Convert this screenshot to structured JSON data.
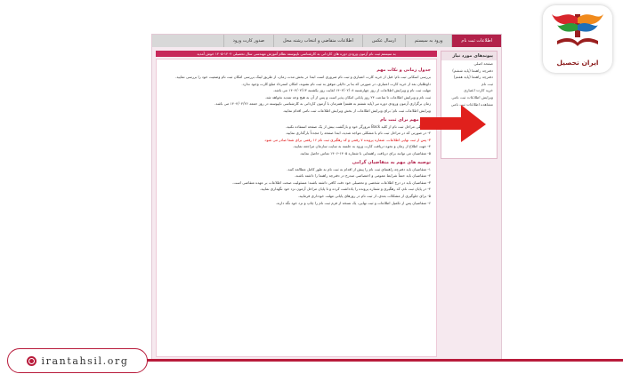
{
  "nav": {
    "items": [
      "اطلاعات ثبت نام",
      "ورود به سیستم",
      "ارسال عکس",
      "اطلاعات متقاضی و انتخاب رشته محل",
      "صدور کارت ورود"
    ]
  },
  "banner": "به سیستم ثبت نام آزمون ورودی دوره های کاردانی به کارشناسی ناپیوسته نظام آموزش مهندسی سال تحصیلی ۱۴۰۴-۱۴۰۵ خوش آمدید",
  "sidebar": {
    "title": "پیوندهای مورد نیاز",
    "items": [
      "صفحه اصلی",
      "دفترچه راهنما (پایه ششم)",
      "دفترچه راهنما (پایه هفتم)",
      "ثبت نام",
      "خرید کارت اعتباری",
      "ویرایش اطلاعات ثبت نامی",
      "مشاهده اطلاعات ثبت نامی"
    ]
  },
  "content": {
    "sec1_title": "جدول زمانی و نکات مهم",
    "sec1_paragraphs": [
      "بررسی اسکانی ثبت نام: قبل از خرید کارت اعتباری و ثبت نام ضروری است ابتدا در بخش مدت زمان، از طریق لینک بررسی امکان ثبت نام وضعیت خود را بررسی نمایید.",
      "داوطلبان بعد از خرید کارت اعتباری، در صورتی که بنا بر دلایلی موفق به ثبت نام نشوند، امکان استرداد مبلغ کارت وجود ندارد.",
      "مهلت ثبت نام و ویرایش اطلاعات از روز چهارشنبه ۱۴۰۴/۰۲/۰۸ لغایت روز یکشنبه ۱۴۰۴/۰۲/۱۳ می باشد.",
      "ثبت نام و ویرایش اطلاعات تا ساعت ۲۴ روز پایانی امکان پذیر است و پس از آن به هیچ وجه تمدید نخواهد شد.",
      "زمان برگزاری آزمون ورودی دوره تیر (پایه ششم به هفتم) همزمان با آزمون کاردانی به کارشناسی ناپیوسته در روز جمعه ۱۴۰۴/۰۲/۲۶ می باشد.",
      "ویرایش اطلاعات ثبت نام: برای ویرایش اطلاعات از بخش ویرایش اطلاعات ثبت نامی اقدام نمایید."
    ],
    "sec2_title": "نکات مهم برای ثبت نام",
    "sec2_paragraphs": [
      "۱- در طی مراحل ثبت نام از کلید Back مرورگر خود و بازگشت بیش از یک صفحه استفاده نکنید.",
      "۲- در صورتی که در مراحل ثبت نام با مشکلی مواجه شدید، ابتدا صفحه را مجدداً بارگذاری نمایید.",
      "۳- پس از ثبت نهایی اطلاعات، شماره پرونده ۷ رقمی و کد رهگیری ثبت نام ۱۶ رقمی برای شما صادر می شود.",
      "۴- جهت اطلاع از زمان و نحوه دریافت کارت ورود به جلسه به سایت سازمان مراجعه نمایید.",
      "۵- متقاضیان می توانند برای دریافت راهنمایی با شماره ۱۴۰۵-۱۴۰۶ تماس حاصل نمایند."
    ],
    "sec3_title": "توصیه های مهم به متقاضیان گرامی",
    "sec3_paragraphs": [
      "۱- متقاضیان باید دفترچه راهنمای ثبت نام را پیش از اقدام به ثبت نام به طور کامل مطالعه کنند.",
      "۲- متقاضیان باید حتماً شرایط عمومی و اختصاصی مندرج در دفترچه راهنما را داشته باشند.",
      "۳- متقاضیان باید در درج اطلاعات شخصی و تحصیلی خود دقت کافی داشته باشند؛ مسئولیت صحت اطلاعات بر عهده متقاضی است.",
      "۴- در پایان ثبت نام، کد رهگیری و شماره پرونده را یادداشت کرده و تا پایان مراحل آزمون نزد خود نگهداری نمایید.",
      "۵- برای جلوگیری از مشکلات بعدی، از ثبت نام در روزهای پایانی مهلت خودداری فرمایید.",
      "۶- متقاضیان پس از تکمیل اطلاعات و ثبت نهایی، یک نسخه از فرم ثبت نام را چاپ و نزد خود نگه دارند."
    ]
  },
  "branding": {
    "logo_text": "ایران تحصیل",
    "site_url": "irantahsil.org",
    "accent_color": "#b81b3b"
  }
}
